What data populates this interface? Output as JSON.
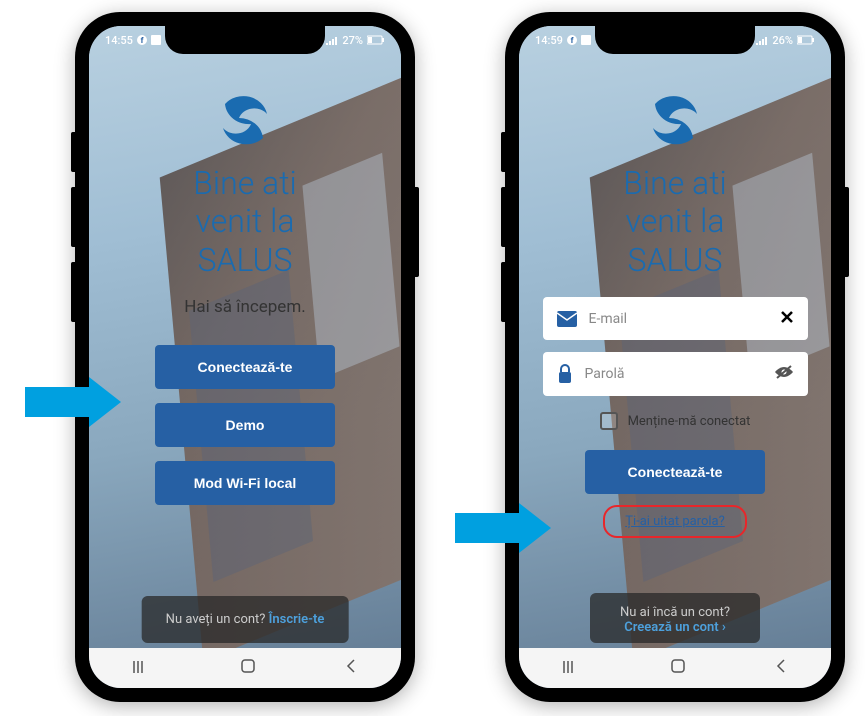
{
  "left_phone": {
    "status": {
      "time": "14:55",
      "battery": "27%"
    },
    "welcome": "Bine ati\nvenit la\nSALUS",
    "subtitle": "Hai să începem.",
    "buttons": {
      "connect": "Conectează-te",
      "demo": "Demo",
      "wifi": "Mod Wi-Fi local"
    },
    "bottom": {
      "text": "Nu aveți un cont? ",
      "link": "Înscrie-te"
    }
  },
  "right_phone": {
    "status": {
      "time": "14:59",
      "battery": "26%"
    },
    "welcome": "Bine ati\nvenit la\nSALUS",
    "fields": {
      "email_placeholder": "E-mail",
      "password_placeholder": "Parolă"
    },
    "remember": "Menține-mă conectat",
    "connect": "Conectează-te",
    "forgot": "Ți-ai uitat parola?",
    "bottom": {
      "text": "Nu ai încă un cont?",
      "link": "Creează un cont ›"
    }
  },
  "nav": {
    "recent": "III",
    "home": "▢",
    "back": "‹"
  }
}
